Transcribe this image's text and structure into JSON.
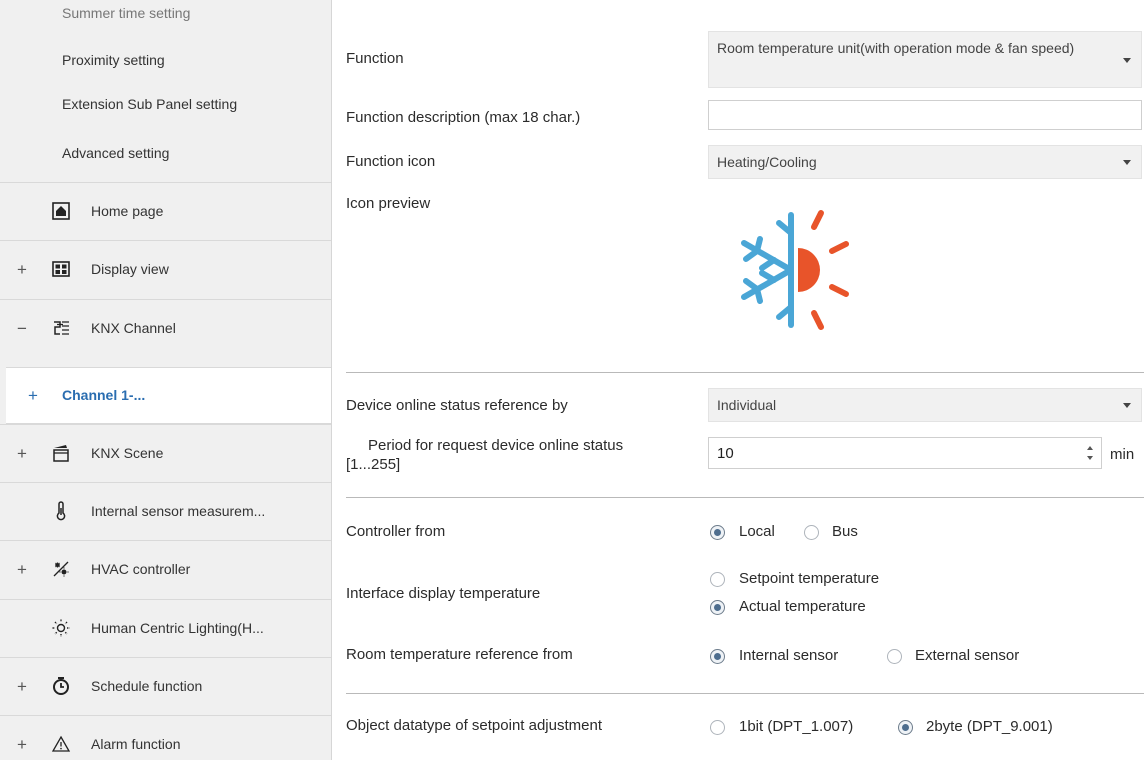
{
  "sidebar": {
    "sub_items": [
      "Summer time setting",
      "Proximity setting",
      "Extension Sub Panel setting",
      "Advanced setting"
    ],
    "nav_items": [
      {
        "toggle": "",
        "icon": "home-icon",
        "label": "Home page"
      },
      {
        "toggle": "+",
        "icon": "display-view-icon",
        "label": "Display view"
      },
      {
        "toggle": "−",
        "icon": "knx-channel-icon",
        "label": "KNX Channel"
      },
      {
        "toggle": "+",
        "icon": "scene-icon",
        "label": "KNX Scene"
      },
      {
        "toggle": "",
        "icon": "thermometer-icon",
        "label": "Internal sensor measurem..."
      },
      {
        "toggle": "+",
        "icon": "hvac-icon",
        "label": "HVAC controller"
      },
      {
        "toggle": "",
        "icon": "sun-icon",
        "label": "Human Centric Lighting(H..."
      },
      {
        "toggle": "+",
        "icon": "clock-icon",
        "label": "Schedule function"
      },
      {
        "toggle": "+",
        "icon": "alarm-icon",
        "label": "Alarm function"
      }
    ],
    "selected_channel": {
      "toggle": "+",
      "label": "Channel 1-..."
    }
  },
  "main": {
    "function_label": "Function",
    "function_value": "Room temperature unit(with operation mode & fan speed)",
    "function_desc_label": "Function description (max 18 char.)",
    "function_desc_value": "",
    "function_icon_label": "Function icon",
    "function_icon_value": "Heating/Cooling",
    "icon_preview_label": "Icon preview",
    "icon_preview_icon": "heating-cooling-icon",
    "online_ref_label": "Device online status reference by",
    "online_ref_value": "Individual",
    "period_label_line1": "Period for request device online status",
    "period_label_line2": "[1...255]",
    "period_value": "10",
    "period_unit": "min",
    "controller_from_label": "Controller from",
    "controller_from_options": [
      "Local",
      "Bus"
    ],
    "controller_from_selected": "Local",
    "display_temp_label": "Interface display temperature",
    "display_temp_options": [
      "Setpoint temperature",
      "Actual temperature"
    ],
    "display_temp_selected": "Actual temperature",
    "room_temp_ref_label": "Room temperature reference from",
    "room_temp_ref_options": [
      "Internal sensor",
      "External sensor"
    ],
    "room_temp_ref_selected": "Internal sensor",
    "datatype_label": "Object datatype of setpoint adjustment",
    "datatype_options": [
      "1bit (DPT_1.007)",
      "2byte (DPT_9.001)"
    ],
    "datatype_selected": "2byte (DPT_9.001)"
  },
  "colors": {
    "accent": "#2a6db0",
    "sidebar_bg": "#f0f0f0",
    "icon_blue": "#4aa6d6",
    "icon_orange": "#e8542a"
  }
}
